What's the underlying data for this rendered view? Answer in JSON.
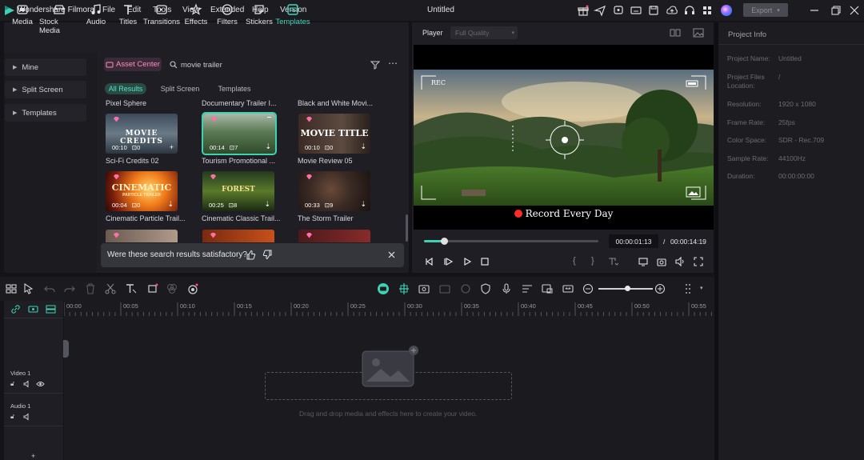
{
  "app": {
    "name": "Wondershare Filmora",
    "menu": [
      "File",
      "Edit",
      "Tools",
      "View",
      "Extended",
      "Help",
      "Version"
    ],
    "document_title": "Untitled",
    "export_label": "Export"
  },
  "media_tabs": [
    {
      "label": "Media",
      "icon": "media-icon"
    },
    {
      "label": "Stock Media",
      "icon": "stock-media-icon"
    },
    {
      "label": "Audio",
      "icon": "audio-icon"
    },
    {
      "label": "Titles",
      "icon": "titles-icon"
    },
    {
      "label": "Transitions",
      "icon": "transitions-icon"
    },
    {
      "label": "Effects",
      "icon": "effects-icon"
    },
    {
      "label": "Filters",
      "icon": "filters-icon"
    },
    {
      "label": "Stickers",
      "icon": "stickers-icon"
    },
    {
      "label": "Templates",
      "icon": "templates-icon",
      "active": true
    }
  ],
  "sidebar": {
    "items": [
      {
        "label": "Mine"
      },
      {
        "label": "Split Screen"
      },
      {
        "label": "Templates"
      }
    ]
  },
  "library": {
    "asset_center_label": "Asset Center",
    "search_value": "movie trailer",
    "filter_tabs": [
      "All Results",
      "Split Screen",
      "Templates"
    ],
    "top_labels": [
      "Pixel Sphere",
      "Documentary Trailer I...",
      "Black and White Movi..."
    ],
    "cards": [
      {
        "title": "Sci-Fi Credits 02",
        "duration": "00:10",
        "count": "0",
        "overlay": "MOVIE CREDITS"
      },
      {
        "title": "Tourism Promotional ...",
        "duration": "00:14",
        "count": "7",
        "overlay": ""
      },
      {
        "title": "Movie Review 05",
        "duration": "00:10",
        "count": "0",
        "overlay": "MOVIE TITLE"
      },
      {
        "title": "Cinematic Particle Trail...",
        "duration": "00:04",
        "count": "0",
        "overlay": "CINEMATIC"
      },
      {
        "title": "Cinematic Classic Trail...",
        "duration": "00:25",
        "count": "8",
        "overlay": "FOREST"
      },
      {
        "title": "The Storm Trailer",
        "duration": "00:33",
        "count": "9",
        "overlay": ""
      }
    ],
    "overlay_subtitle": "PARTICLE TRAILER",
    "feedback_question": "Were these search results satisfactory?"
  },
  "player": {
    "tab_label": "Player",
    "quality": "Full Quality",
    "rec_label": "REC",
    "caption": "Record Every Day",
    "progress": 0.12,
    "current_time": "00:00:01:13",
    "separator": "/",
    "total_time": "00:00:14:19"
  },
  "project_info": {
    "title": "Project Info",
    "rows": [
      {
        "label": "Project Name:",
        "value": "Untitled"
      },
      {
        "label": "Project Files Location:",
        "value": "/"
      },
      {
        "label": "Resolution:",
        "value": "1920 x 1080"
      },
      {
        "label": "Frame Rate:",
        "value": "25fps"
      },
      {
        "label": "Color Space:",
        "value": "SDR - Rec.709"
      },
      {
        "label": "Sample Rate:",
        "value": "44100Hz"
      },
      {
        "label": "Duration:",
        "value": "00:00:00:00"
      }
    ]
  },
  "timeline": {
    "ticks": [
      "00:00",
      "00:05",
      "00:10",
      "00:15",
      "00:20",
      "00:25",
      "00:30",
      "00:35",
      "00:40",
      "00:45",
      "00:50",
      "00:55"
    ],
    "tracks": [
      "Video 1",
      "Audio 1"
    ],
    "drop_hint": "Drag and drop media and effects here to create your video.",
    "add_track": "+"
  },
  "colors": {
    "accent": "#3fd1b4",
    "asset_center": "#ff8fb4",
    "background": "#141418"
  }
}
